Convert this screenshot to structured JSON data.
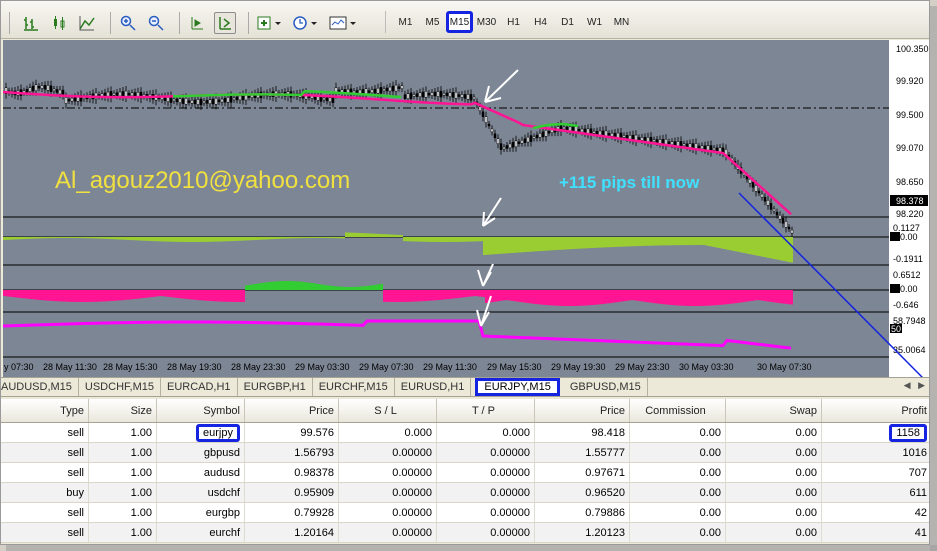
{
  "toolbar": {
    "timeframes": [
      "M1",
      "M5",
      "M15",
      "M30",
      "H1",
      "H4",
      "D1",
      "W1",
      "MN"
    ],
    "selected_timeframe": "M15"
  },
  "chart": {
    "price_labels": [
      "100.350",
      "99.920",
      "99.500",
      "99.070",
      "98.650",
      "98.378",
      "98.220"
    ],
    "ind1_labels": [
      "0.1127",
      "0.00",
      "-0.1911"
    ],
    "ind2_labels": [
      "0.6512",
      "0.00",
      "-0.646"
    ],
    "ind3_labels": [
      "58.7948",
      "50",
      "35.0064"
    ],
    "time_labels": [
      "y 07:30",
      "28 May 11:30",
      "28 May 15:30",
      "28 May 19:30",
      "28 May 23:30",
      "29 May 03:30",
      "29 May 07:30",
      "29 May 11:30",
      "29 May 15:30",
      "29 May 19:30",
      "29 May 23:30",
      "30 May 03:30",
      "30 May 07:30"
    ],
    "email_text": "Al_agouz2010@yahoo.com",
    "pips_text": "+115 pips till now",
    "colors": {
      "background": "#7d8694",
      "candle": "#000000",
      "ma_line": "#ff1493",
      "trend_green": "#32cd32",
      "hist_green": "#9acd32",
      "hist_magenta": "#ff1493",
      "email": "#f0e040",
      "pips": "#40e0ff",
      "annotation": "#1424e0"
    }
  },
  "tabs": {
    "items": [
      "AUDUSD,M15",
      "USDCHF,M15",
      "EURCAD,H1",
      "EURGBP,H1",
      "EURCHF,M15",
      "EURUSD,H1",
      "EURJPY,M15",
      "GBPUSD,M15"
    ],
    "selected": "EURJPY,M15"
  },
  "table": {
    "headers": [
      "Type",
      "Size",
      "Symbol",
      "Price",
      "S / L",
      "T / P",
      "Price",
      "Commission",
      "Swap",
      "Profit"
    ],
    "rows": [
      {
        "type": "sell",
        "size": "1.00",
        "symbol": "eurjpy",
        "price": "99.576",
        "sl": "0.000",
        "tp": "0.000",
        "price2": "98.418",
        "commission": "0.00",
        "swap": "0.00",
        "profit": "1158"
      },
      {
        "type": "sell",
        "size": "1.00",
        "symbol": "gbpusd",
        "price": "1.56793",
        "sl": "0.00000",
        "tp": "0.00000",
        "price2": "1.55777",
        "commission": "0.00",
        "swap": "0.00",
        "profit": "1016"
      },
      {
        "type": "sell",
        "size": "1.00",
        "symbol": "audusd",
        "price": "0.98378",
        "sl": "0.00000",
        "tp": "0.00000",
        "price2": "0.97671",
        "commission": "0.00",
        "swap": "0.00",
        "profit": "707"
      },
      {
        "type": "buy",
        "size": "1.00",
        "symbol": "usdchf",
        "price": "0.95909",
        "sl": "0.00000",
        "tp": "0.00000",
        "price2": "0.96520",
        "commission": "0.00",
        "swap": "0.00",
        "profit": "611"
      },
      {
        "type": "sell",
        "size": "1.00",
        "symbol": "eurgbp",
        "price": "0.79928",
        "sl": "0.00000",
        "tp": "0.00000",
        "price2": "0.79886",
        "commission": "0.00",
        "swap": "0.00",
        "profit": "42"
      },
      {
        "type": "sell",
        "size": "1.00",
        "symbol": "eurchf",
        "price": "1.20164",
        "sl": "0.00000",
        "tp": "0.00000",
        "price2": "1.20123",
        "commission": "0.00",
        "swap": "0.00",
        "profit": "41"
      }
    ]
  }
}
